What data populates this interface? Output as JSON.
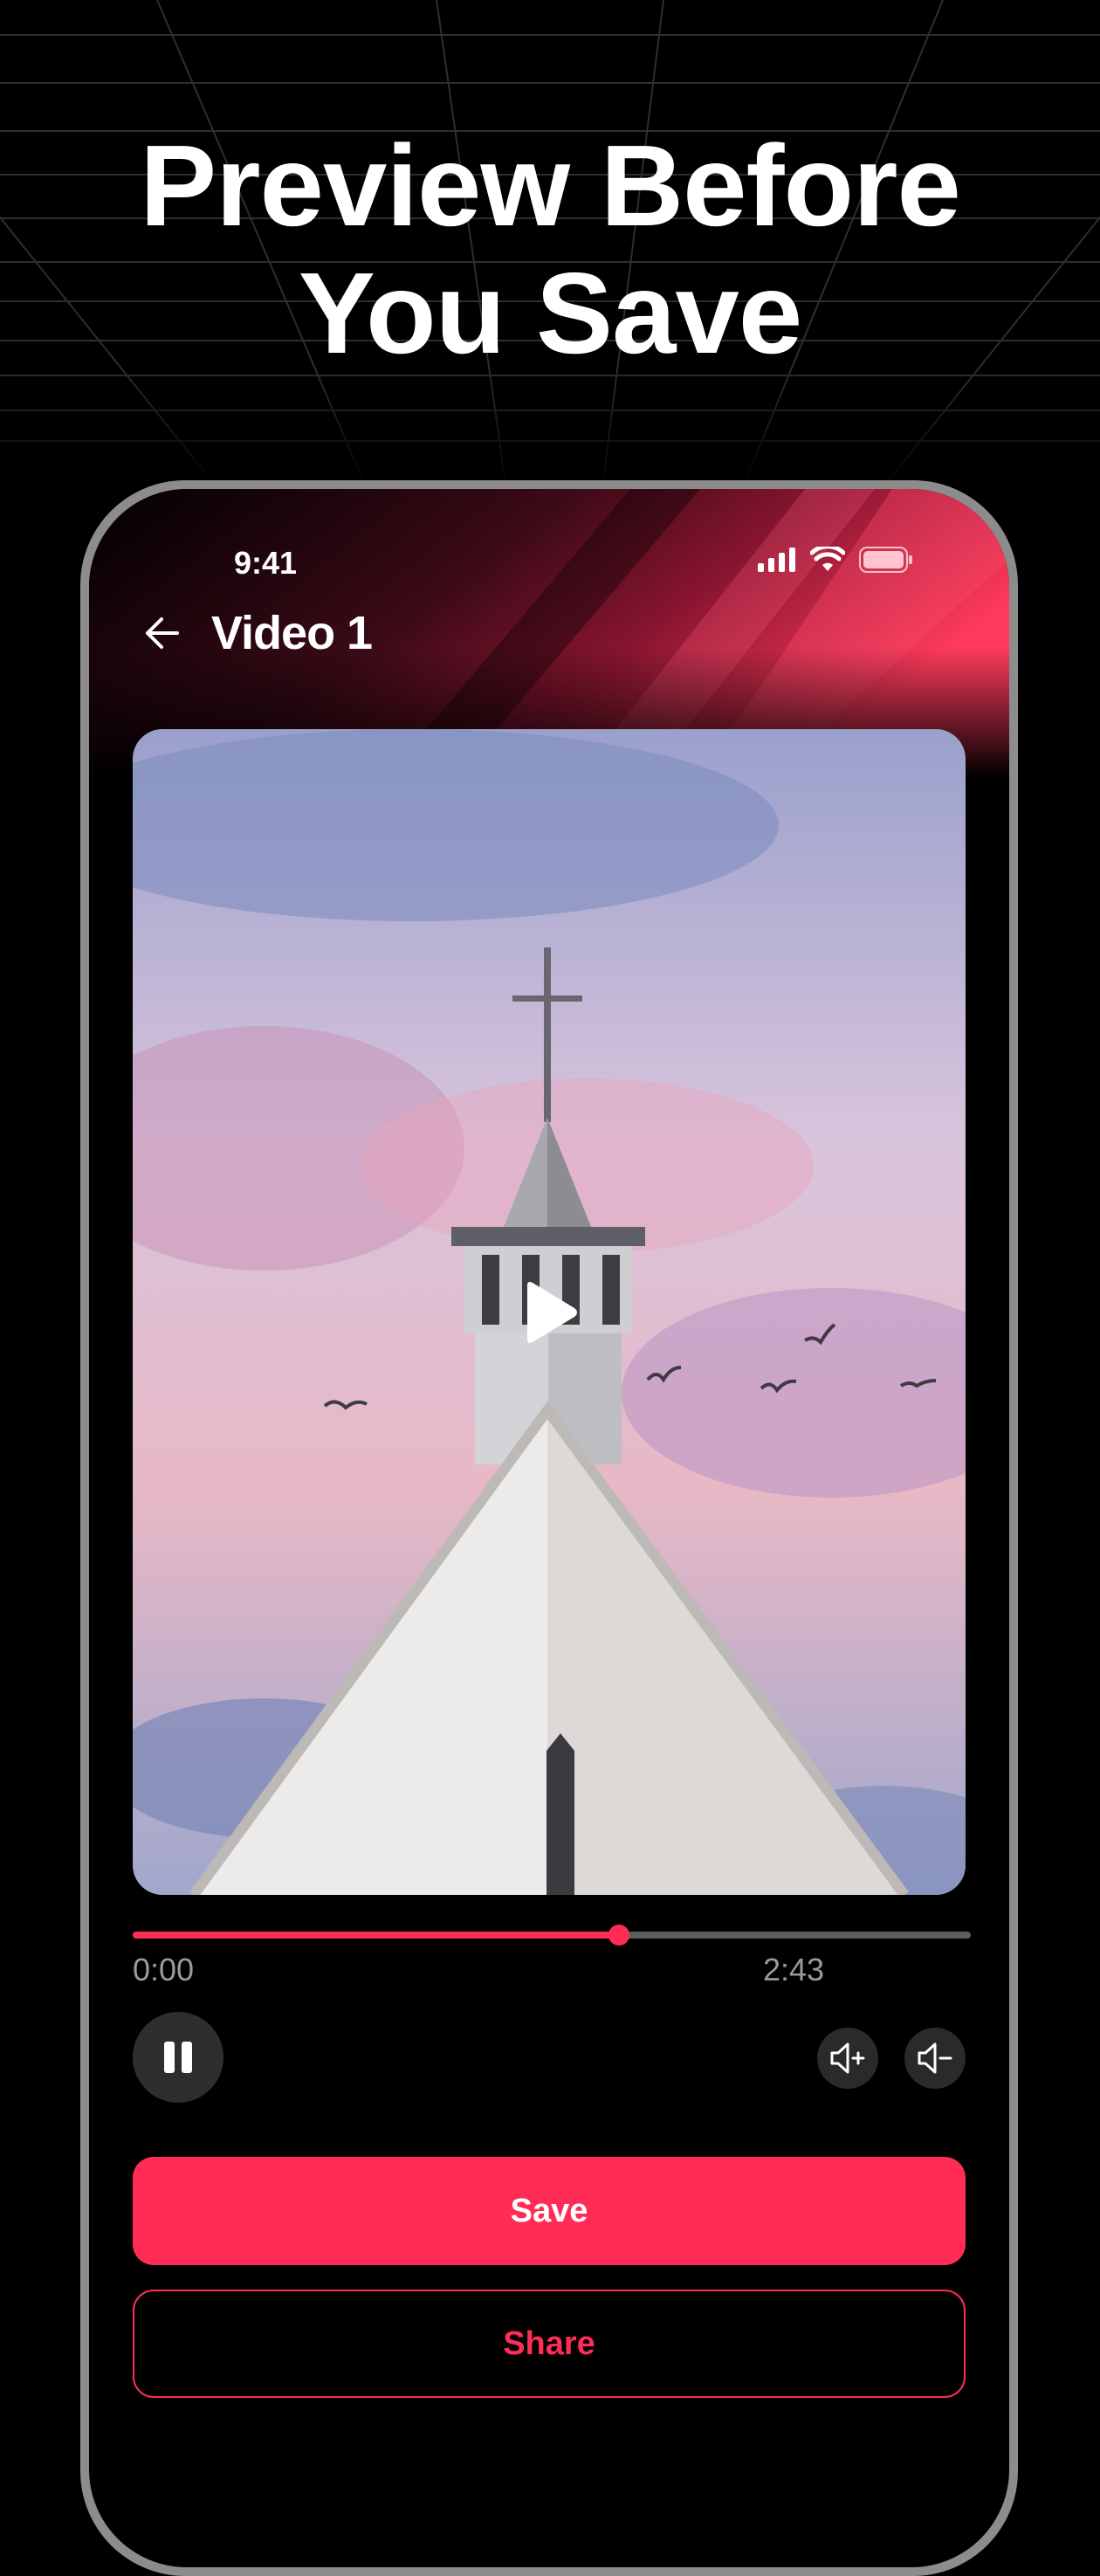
{
  "headline": {
    "line1": "Preview Before",
    "line2": "You Save"
  },
  "status_bar": {
    "time": "9:41",
    "icons": [
      "signal-icon",
      "wifi-icon",
      "battery-icon"
    ]
  },
  "nav": {
    "back_icon": "arrow-left-icon",
    "title": "Video 1"
  },
  "player": {
    "play_icon": "play-icon",
    "progress_fraction": 0.58,
    "time_current": "0:00",
    "time_total": "2:43",
    "pause_icon": "pause-icon",
    "volume_up_icon": "volume-up-icon",
    "volume_down_icon": "volume-down-icon"
  },
  "actions": {
    "save_label": "Save",
    "share_label": "Share"
  },
  "colors": {
    "accent": "#ff2d55",
    "background": "#000000",
    "track": "#5d5d5d"
  }
}
